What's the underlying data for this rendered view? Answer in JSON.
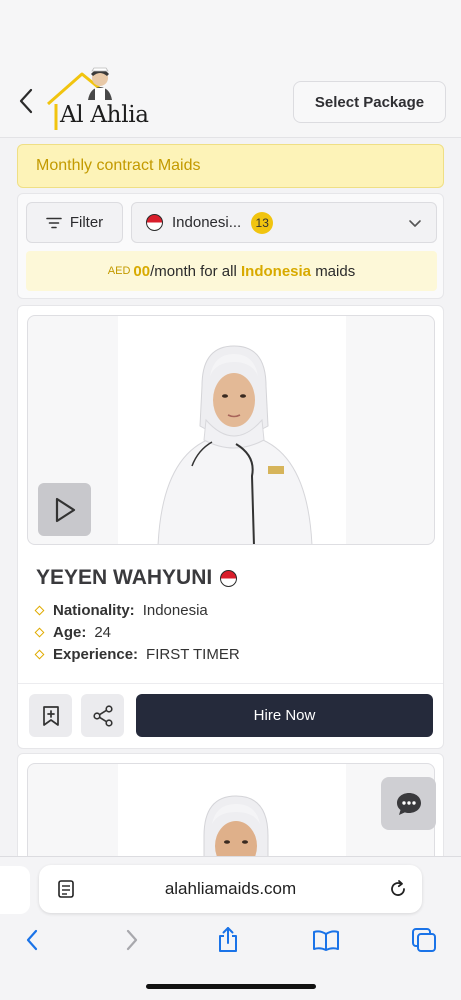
{
  "header": {
    "logo_text": "Al Ahlia",
    "select_package_label": "Select Package"
  },
  "banner": {
    "text": "Monthly contract Maids"
  },
  "filters": {
    "filter_label": "Filter",
    "nationality_value": "Indonesi...",
    "nationality_count": "13",
    "price_currency": "AED",
    "price_amount": "00",
    "price_text": "/month for all",
    "price_nationality": "Indonesia",
    "price_suffix": "maids"
  },
  "maid": {
    "name": "YEYEN WAHYUNI",
    "details": [
      {
        "label": "Nationality:",
        "value": "Indonesia"
      },
      {
        "label": "Age:",
        "value": "24"
      },
      {
        "label": "Experience:",
        "value": "FIRST TIMER"
      }
    ],
    "hire_label": "Hire Now"
  },
  "browser": {
    "url": "alahliamaids.com"
  },
  "colors": {
    "accent_yellow": "#f1c40f",
    "hire_button": "#252a3b",
    "banner_bg": "#fdf3b8",
    "ios_blue": "#1a73e8"
  },
  "icons": {
    "back": "chevron-left-icon",
    "filter": "filter-lines-icon",
    "flag": "indonesia-flag-icon",
    "dropdown": "chevron-down-icon",
    "video": "play-icon",
    "save": "bookmark-plus-icon",
    "share": "share-icon",
    "chat": "chat-bubble-icon"
  }
}
